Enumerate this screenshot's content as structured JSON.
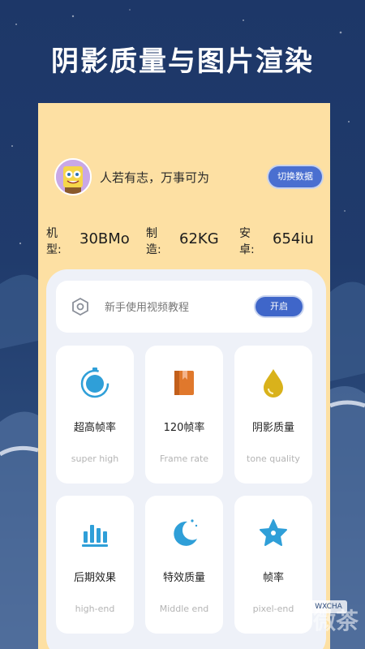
{
  "banner": {
    "title": "阴影质量与图片渲染"
  },
  "profile": {
    "motto": "人若有志，万事可为",
    "switch_label": "切换数据"
  },
  "specs": [
    {
      "key": "机型:",
      "value": "30BMo"
    },
    {
      "key": "制造:",
      "value": "62KG"
    },
    {
      "key": "安卓:",
      "value": "654iu"
    }
  ],
  "guide": {
    "text": "新手使用视频教程",
    "button_label": "开启"
  },
  "cards": [
    {
      "icon": "timer-icon",
      "name": "超高帧率",
      "sub": "super high"
    },
    {
      "icon": "book-icon",
      "name": "120帧率",
      "sub": "Frame rate"
    },
    {
      "icon": "drop-icon",
      "name": "阴影质量",
      "sub": "tone quality"
    },
    {
      "icon": "bar-chart-icon",
      "name": "后期效果",
      "sub": "high-end"
    },
    {
      "icon": "moon-icon",
      "name": "特效质量",
      "sub": "Middle end"
    },
    {
      "icon": "star-icon",
      "name": "帧率",
      "sub": "pixel-end"
    }
  ],
  "watermark": {
    "text": "微茶",
    "badge": "WXCHA"
  },
  "colors": {
    "background": "#1d3768",
    "phone": "#fde0a3",
    "accent": "#4a6fd0",
    "icon_blue": "#2f9fd8",
    "icon_orange": "#e0782c",
    "icon_yellow": "#d9b21b"
  }
}
